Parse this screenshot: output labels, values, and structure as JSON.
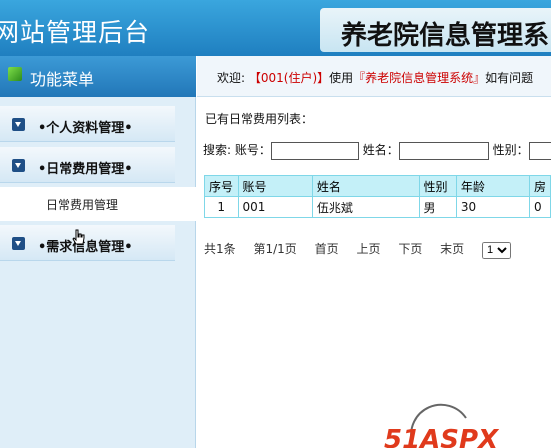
{
  "header": {
    "site_title": "网站管理后台",
    "system_title": "养老院信息管理系"
  },
  "sidebar": {
    "menu_title": "功能菜单",
    "groups": [
      {
        "label": "•个人资料管理•"
      },
      {
        "label": "•日常费用管理•"
      },
      {
        "label": "•需求信息管理•"
      }
    ],
    "subitem": "日常费用管理"
  },
  "topbar": {
    "welcome_prefix": "欢迎: ",
    "user": "【001(住户)】",
    "mid": "使用",
    "system": "『养老院信息管理系统』",
    "suffix": "如有问题"
  },
  "main": {
    "list_title": "已有日常费用列表：",
    "search_label": "搜索:",
    "fields": [
      "账号：",
      "姓名：",
      "性别："
    ],
    "columns": [
      "序号",
      "账号",
      "姓名",
      "性别",
      "年龄",
      "房"
    ],
    "rows": [
      [
        "1",
        "001",
        "伍兆斌",
        "男",
        "30",
        "0"
      ]
    ],
    "pager": {
      "total": "共1条",
      "page": "第1/1页",
      "first": "首页",
      "prev": "上页",
      "next": "下页",
      "last": "末页",
      "selected": "1"
    }
  },
  "watermark": "51ASPX"
}
